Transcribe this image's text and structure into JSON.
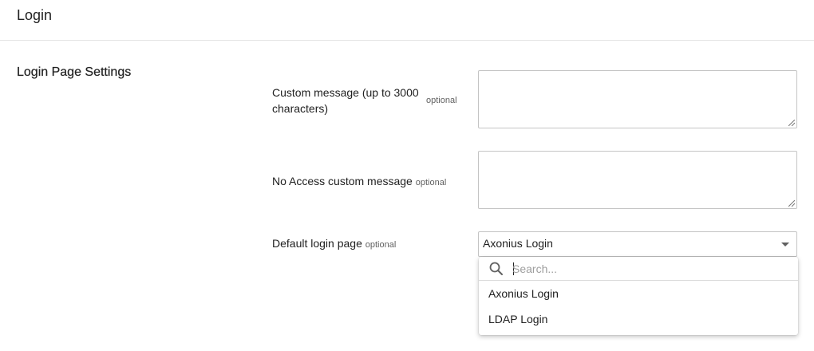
{
  "header": {
    "title": "Login"
  },
  "section": {
    "title": "Login Page Settings"
  },
  "fields": {
    "optional_tag": "optional",
    "custom_message": {
      "label": "Custom message (up to 3000 characters)",
      "value": ""
    },
    "no_access_message": {
      "label": "No Access custom message",
      "value": ""
    },
    "default_login_page": {
      "label": "Default login page",
      "selected": "Axonius Login",
      "search_placeholder": "Search...",
      "options": [
        "Axonius Login",
        "LDAP Login"
      ]
    }
  }
}
